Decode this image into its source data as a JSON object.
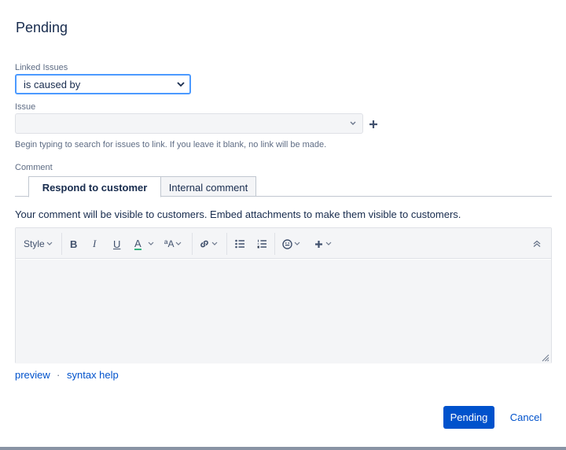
{
  "dialog": {
    "title": "Pending"
  },
  "linked_issues": {
    "label": "Linked Issues",
    "selected": "is caused by"
  },
  "issue": {
    "label": "Issue",
    "value": "",
    "help": "Begin typing to search for issues to link. If you leave it blank, no link will be made."
  },
  "comment": {
    "label": "Comment",
    "tabs": [
      {
        "label": "Respond to customer",
        "active": true
      },
      {
        "label": "Internal comment",
        "active": false
      }
    ],
    "visibility_note": "Your comment will be visible to customers. Embed attachments to make them visible to customers.",
    "toolbar": {
      "style_label": "Style",
      "bold": "B",
      "italic": "I",
      "underline": "U",
      "text_color": "A",
      "text_size": "ªA"
    }
  },
  "links": {
    "preview": "preview",
    "syntax_help": "syntax help",
    "separator": "·"
  },
  "actions": {
    "submit": "Pending",
    "cancel": "Cancel"
  },
  "colors": {
    "accent": "#0052cc",
    "focus": "#4c9aff",
    "text_color_bar": "#36b37e"
  }
}
